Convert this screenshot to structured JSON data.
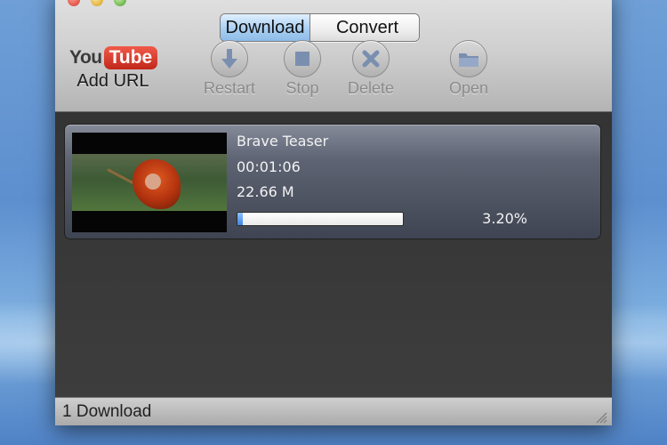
{
  "toolbar": {
    "segments": [
      {
        "label": "Download",
        "active": true
      },
      {
        "label": "Convert",
        "active": false
      }
    ],
    "youtube_logo": {
      "you": "You",
      "tube": "Tube"
    },
    "add_url_label": "Add URL",
    "buttons": [
      {
        "label": "Restart",
        "icon": "restart-arrow-icon"
      },
      {
        "label": "Stop",
        "icon": "stop-square-icon"
      },
      {
        "label": "Delete",
        "icon": "delete-x-icon"
      },
      {
        "label": "Open",
        "icon": "folder-icon"
      }
    ]
  },
  "downloads": [
    {
      "title": "Brave Teaser",
      "duration": "00:01:06",
      "size": "22.66 M",
      "progress_percent": 3.2,
      "progress_label": "3.20%"
    }
  ],
  "status": {
    "text": "1 Download"
  },
  "colors": {
    "youtube_red": "#c1261a",
    "progress_blue": "#3d86e6",
    "segment_active": "#a9cff2"
  }
}
